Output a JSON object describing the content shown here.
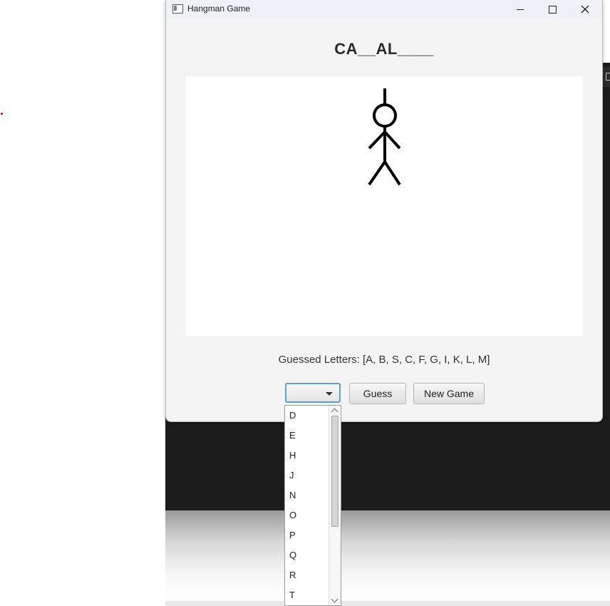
{
  "window": {
    "title": "Hangman Game"
  },
  "game": {
    "word_display": "CA__AL____",
    "guessed_letters_text": "Guessed Letters: [A, B, S, C, F, G, I, K, L, M]"
  },
  "controls": {
    "combo_value": "",
    "guess_label": "Guess",
    "new_game_label": "New Game"
  },
  "dropdown": {
    "options": [
      "D",
      "E",
      "H",
      "J",
      "N",
      "O",
      "P",
      "Q",
      "R",
      "T"
    ]
  },
  "icons": {
    "app": "window-app-icon",
    "minimize": "minimize-icon",
    "maximize": "maximize-icon",
    "close": "close-icon",
    "combo_arrow": "chevron-down-icon"
  },
  "colors": {
    "focus_border": "#5a9fd4",
    "stroke": "#000000"
  }
}
